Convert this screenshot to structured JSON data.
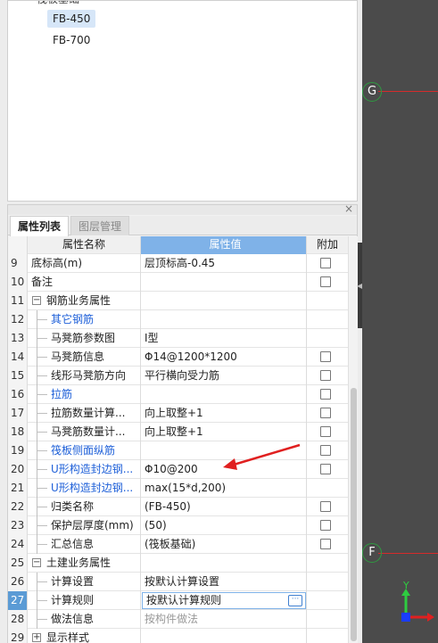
{
  "tree": {
    "header": "筏板基础",
    "items": [
      {
        "label": "FB-450",
        "selected": true
      },
      {
        "label": "FB-700",
        "selected": false
      }
    ]
  },
  "panel": {
    "close_label": "×",
    "tabs": [
      "属性列表",
      "图层管理"
    ]
  },
  "grid": {
    "headers": {
      "name": "属性名称",
      "value": "属性值",
      "add": "附加"
    },
    "rows": [
      {
        "num": "9",
        "name": "底标高(m)",
        "value": "层顶标高-0.45",
        "checkbox": true
      },
      {
        "num": "10",
        "name": "备注",
        "value": "",
        "checkbox": true
      },
      {
        "num": "11",
        "name": "钢筋业务属性",
        "value": "",
        "checkbox": false
      },
      {
        "num": "12",
        "name": "其它钢筋",
        "value": "",
        "checkbox": false
      },
      {
        "num": "13",
        "name": "马凳筋参数图",
        "value": "Ⅰ型",
        "checkbox": false
      },
      {
        "num": "14",
        "name": "马凳筋信息",
        "value": "Φ14@1200*1200",
        "checkbox": true
      },
      {
        "num": "15",
        "name": "线形马凳筋方向",
        "value": "平行横向受力筋",
        "checkbox": true
      },
      {
        "num": "16",
        "name": "拉筋",
        "value": "",
        "checkbox": true
      },
      {
        "num": "17",
        "name": "拉筋数量计算...",
        "value": "向上取整+1",
        "checkbox": true
      },
      {
        "num": "18",
        "name": "马凳筋数量计...",
        "value": "向上取整+1",
        "checkbox": true
      },
      {
        "num": "19",
        "name": "筏板侧面纵筋",
        "value": "",
        "checkbox": true
      },
      {
        "num": "20",
        "name": "U形构造封边钢...",
        "value": "Φ10@200",
        "checkbox": true
      },
      {
        "num": "21",
        "name": "U形构造封边钢...",
        "value": "max(15*d,200)",
        "checkbox": false
      },
      {
        "num": "22",
        "name": "归类名称",
        "value": "(FB-450)",
        "checkbox": true
      },
      {
        "num": "23",
        "name": "保护层厚度(mm)",
        "value": "(50)",
        "checkbox": true
      },
      {
        "num": "24",
        "name": "汇总信息",
        "value": "(筏板基础)",
        "checkbox": true
      },
      {
        "num": "25",
        "name": "土建业务属性",
        "value": "",
        "checkbox": false
      },
      {
        "num": "26",
        "name": "计算设置",
        "value": "按默认计算设置",
        "checkbox": false
      },
      {
        "num": "27",
        "name": "计算规则",
        "value": "按默认计算规则",
        "checkbox": false
      },
      {
        "num": "28",
        "name": "做法信息",
        "value": "按构件做法",
        "checkbox": false
      },
      {
        "num": "29",
        "name": "显示样式",
        "value": "",
        "checkbox": false
      }
    ],
    "dots_label": "···"
  },
  "viewport": {
    "axis_labels": [
      "G",
      "F"
    ],
    "coord_axis_label": "Y"
  },
  "colors": {
    "accent": "#7fb2e8",
    "link": "#1d5fd8",
    "annotation_arrow": "#e02020",
    "axis_line": "#d62b2b",
    "axis_bubble": "#2e9b40"
  }
}
